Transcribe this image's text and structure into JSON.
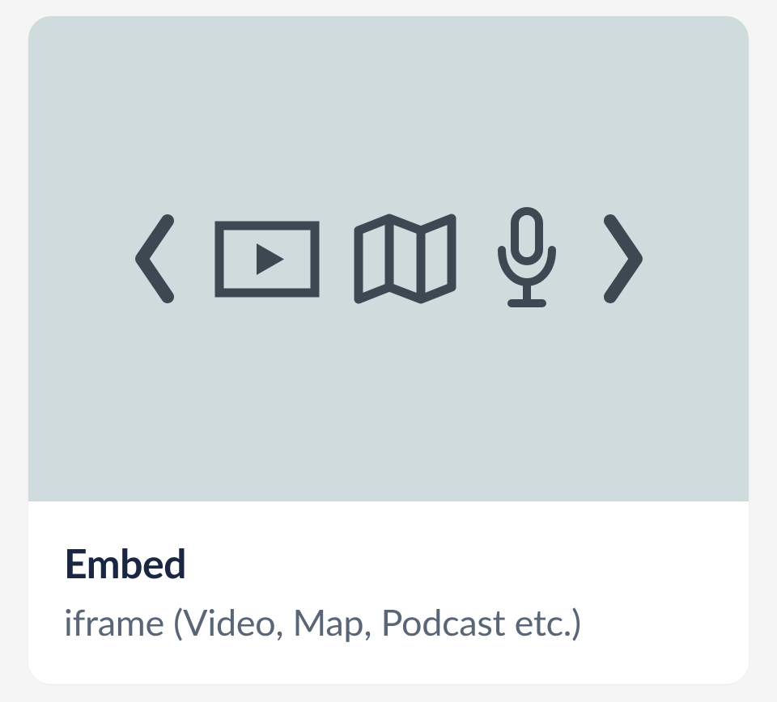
{
  "card": {
    "title": "Embed",
    "subtitle": "iframe (Video, Map, Podcast etc.)",
    "icons": {
      "left_chevron": "chevron-left-icon",
      "video": "video-play-icon",
      "map": "map-icon",
      "microphone": "microphone-icon",
      "right_chevron": "chevron-right-icon"
    },
    "colors": {
      "preview_bg": "#cfdbdd",
      "icon_color": "#3d4852",
      "title_color": "#1b2742",
      "subtitle_color": "#5a6675"
    }
  }
}
